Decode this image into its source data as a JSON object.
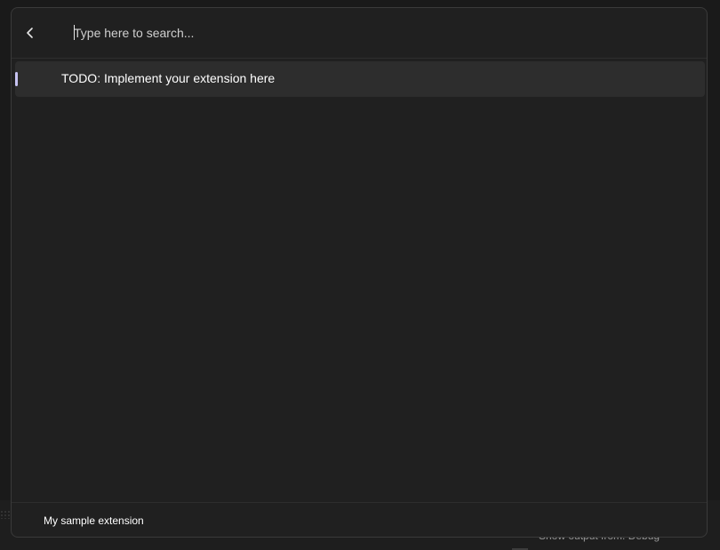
{
  "search": {
    "placeholder": "Type here to search...",
    "value": ""
  },
  "header": {
    "back_icon": "chevron-left-icon"
  },
  "results": [
    {
      "label": "TODO: Implement your extension here",
      "selected": true
    }
  ],
  "footer": {
    "title": "My sample extension"
  },
  "background": {
    "output_text": "Show output from: Debug"
  },
  "colors": {
    "palette_bg": "#202020",
    "selected_item_bg": "#2d2d2d",
    "accent_indicator": "#c7c3f2",
    "text_primary": "#ffffff"
  }
}
